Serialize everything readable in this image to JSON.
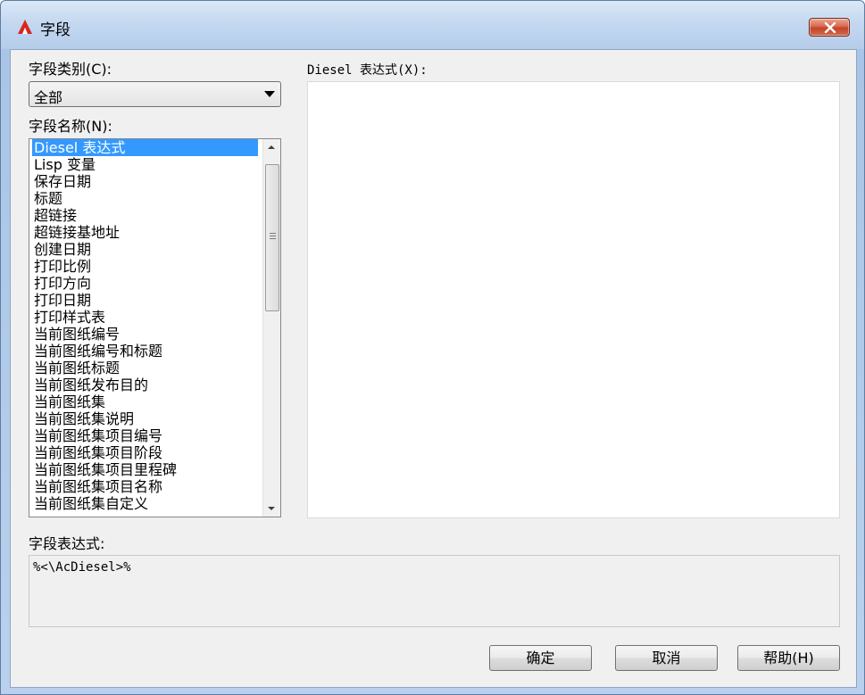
{
  "window": {
    "title": "字段",
    "close_icon": "close-icon"
  },
  "category": {
    "label": "字段类别(C):",
    "selected": "全部"
  },
  "field_names": {
    "label": "字段名称(N):",
    "items": [
      "Diesel 表达式",
      "Lisp 变量",
      "保存日期",
      "标题",
      "超链接",
      "超链接基地址",
      "创建日期",
      "打印比例",
      "打印方向",
      "打印日期",
      "打印样式表",
      "当前图纸编号",
      "当前图纸编号和标题",
      "当前图纸标题",
      "当前图纸发布目的",
      "当前图纸集",
      "当前图纸集说明",
      "当前图纸集项目编号",
      "当前图纸集项目阶段",
      "当前图纸集项目里程碑",
      "当前图纸集项目名称",
      "当前图纸集自定义"
    ],
    "selected_index": 0
  },
  "diesel": {
    "label": "Diesel 表达式(X):"
  },
  "expression": {
    "label": "字段表达式:",
    "value": "%<\\AcDiesel>%"
  },
  "buttons": {
    "ok": "确定",
    "cancel": "取消",
    "help": "帮助(H)"
  },
  "colors": {
    "selection": "#3399ff",
    "close_button": "#c94a2c"
  }
}
